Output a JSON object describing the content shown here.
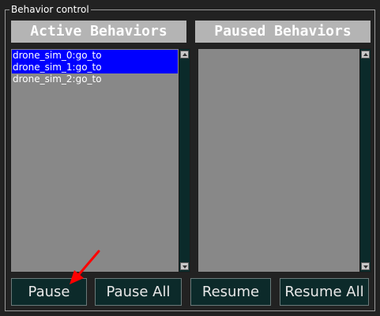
{
  "group": {
    "title": "Behavior control"
  },
  "active_panel": {
    "header": "Active Behaviors",
    "items": [
      {
        "label": "drone_sim_0:go_to",
        "selected": true
      },
      {
        "label": "drone_sim_1:go_to",
        "selected": true
      },
      {
        "label": "drone_sim_2:go_to",
        "selected": false
      }
    ]
  },
  "paused_panel": {
    "header": "Paused Behaviors",
    "items": []
  },
  "buttons": {
    "pause": "Pause",
    "pause_all": "Pause All",
    "resume": "Resume",
    "resume_all": "Resume All"
  },
  "colors": {
    "selection": "#0000ff",
    "header_bg": "#b4b4b4",
    "list_bg": "#888888",
    "button_bg": "#0c2a2a",
    "annotation_arrow": "#ff0000"
  }
}
